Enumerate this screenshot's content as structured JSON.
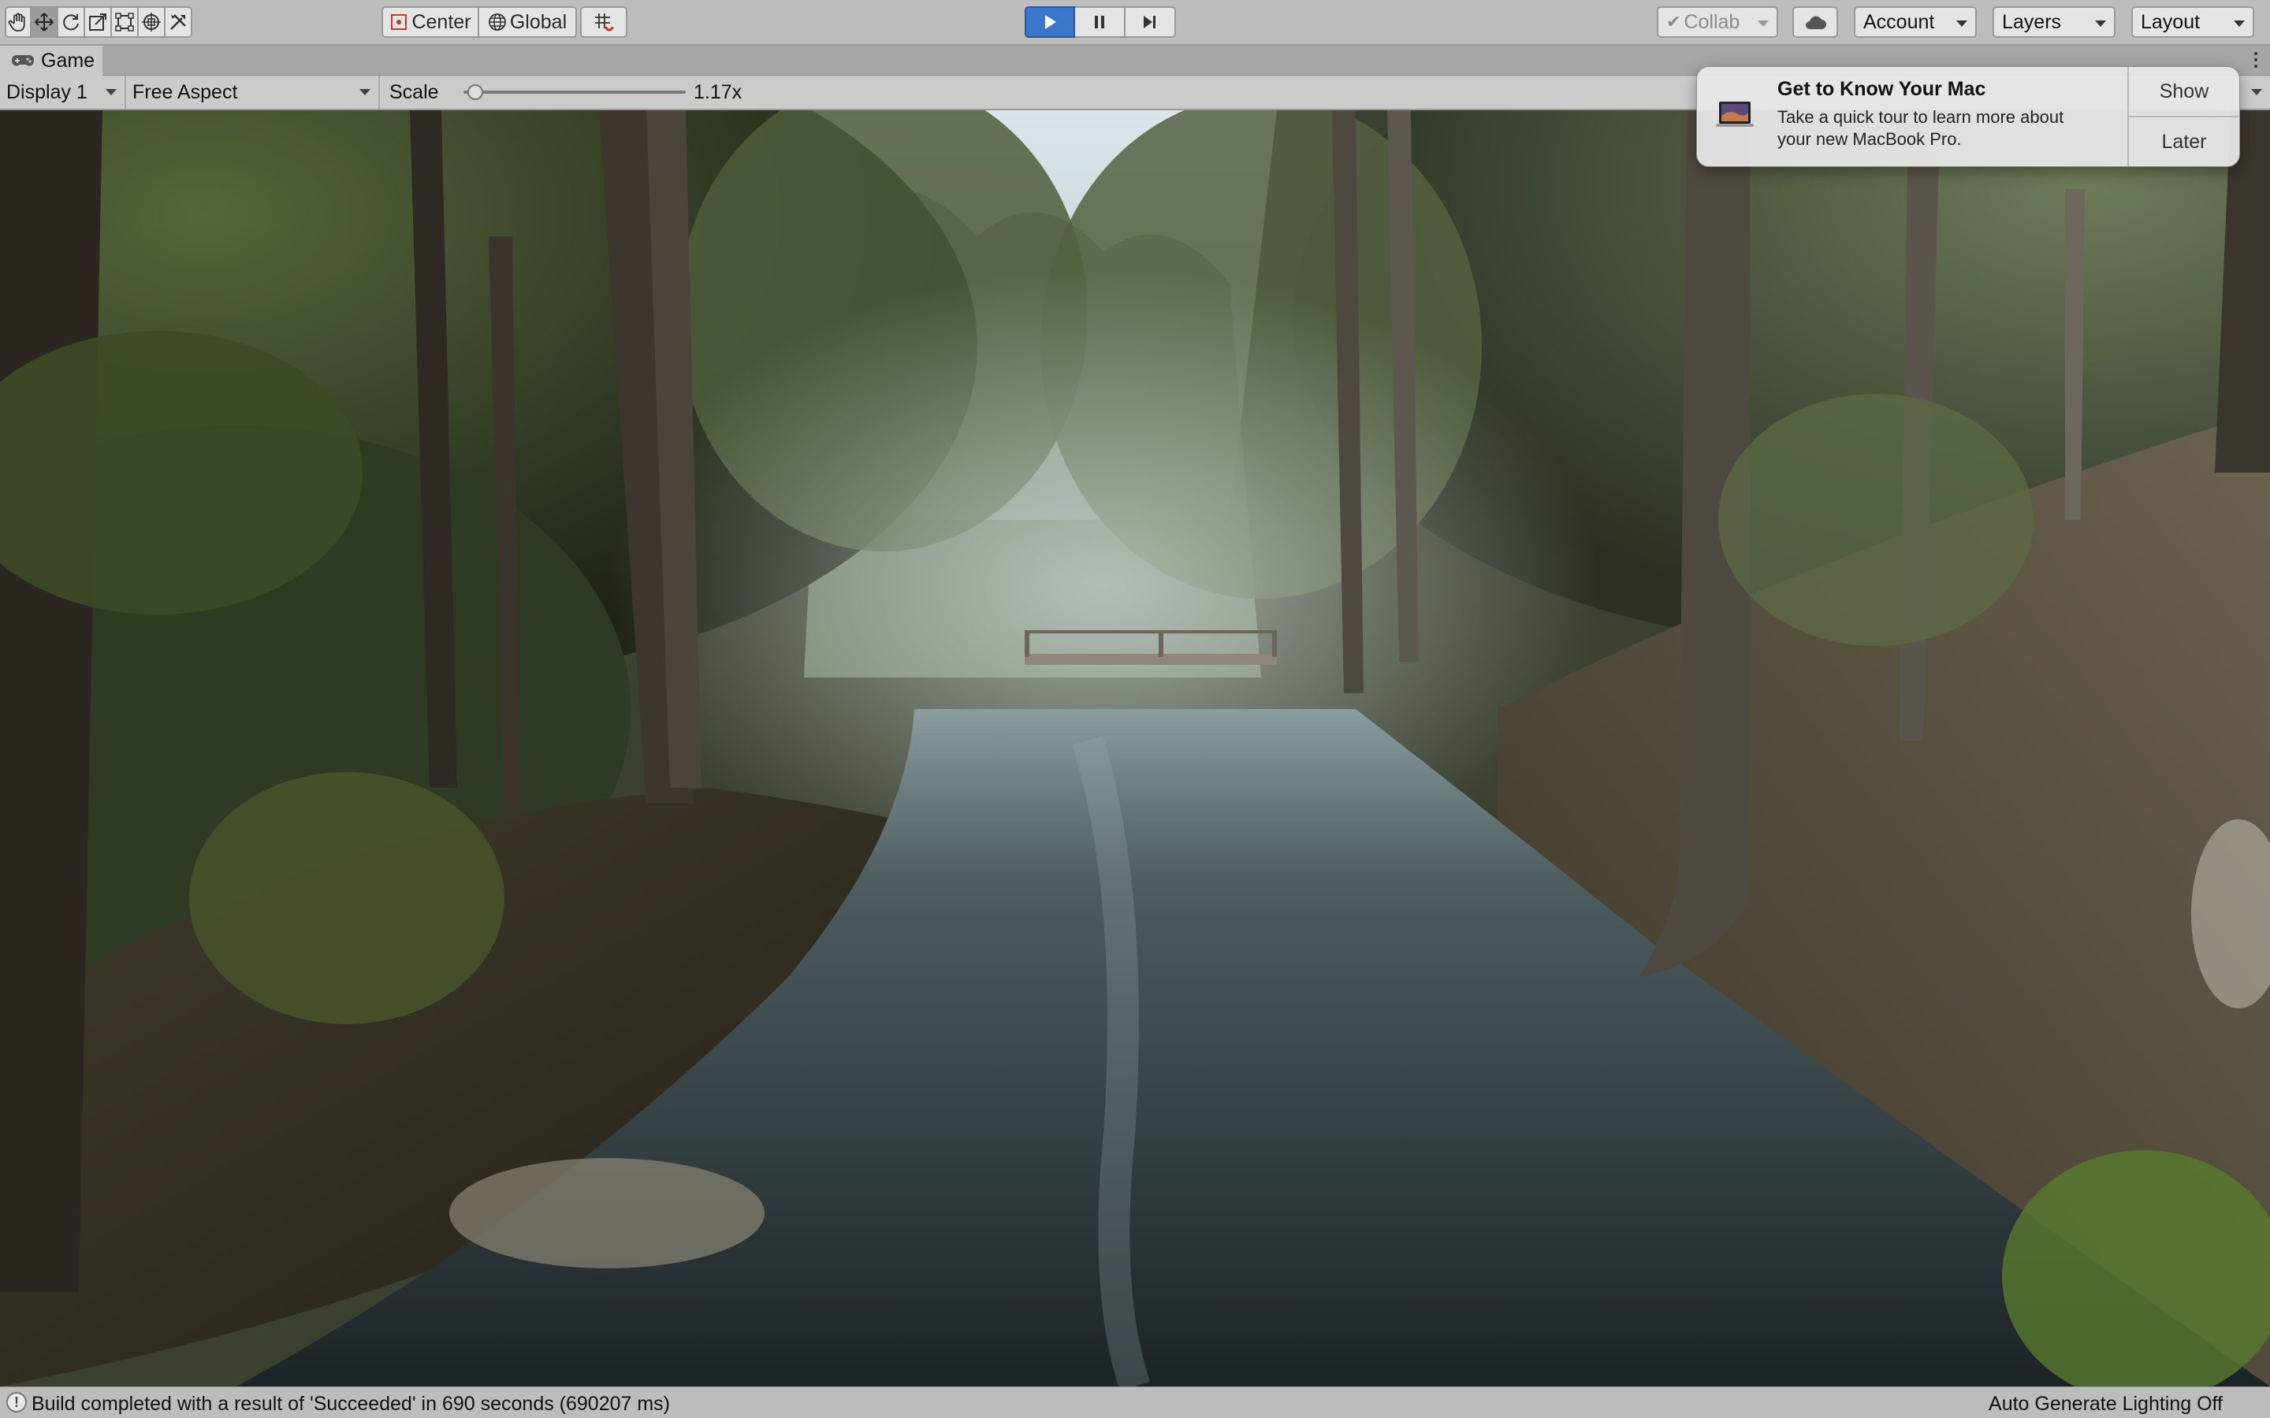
{
  "toolbar": {
    "tools": [
      {
        "name": "hand-tool",
        "icon": "hand-icon"
      },
      {
        "name": "move-tool",
        "icon": "move-icon",
        "active": true
      },
      {
        "name": "rotate-tool",
        "icon": "rotate-icon"
      },
      {
        "name": "scale-tool",
        "icon": "scale-icon"
      },
      {
        "name": "rect-tool",
        "icon": "rect-icon"
      },
      {
        "name": "transform-tool",
        "icon": "transform-icon"
      },
      {
        "name": "custom-tool",
        "icon": "tools-icon"
      }
    ],
    "pivot_label": "Center",
    "space_label": "Global",
    "snap_icon": "grid-snap-icon",
    "play_state": "playing",
    "collab_label": "Collab",
    "cloud_icon": "cloud-icon",
    "account_label": "Account",
    "layers_label": "Layers",
    "layout_label": "Layout"
  },
  "tab": {
    "icon": "gamepad-icon",
    "label": "Game"
  },
  "game_controls": {
    "display": "Display 1",
    "aspect": "Free Aspect",
    "scale_label": "Scale",
    "scale_value": "1.17x",
    "scale_position": 0.02
  },
  "notification": {
    "title": "Get to Know Your Mac",
    "body": "Take a quick tour to learn more about your new MacBook Pro.",
    "show_label": "Show",
    "later_label": "Later"
  },
  "status": {
    "icon": "info-icon",
    "message": "Build completed with a result of 'Succeeded' in 690 seconds (690207 ms)",
    "right_text": "Auto Generate Lighting Off"
  },
  "colors": {
    "toolbar_bg": "#bdbdbd",
    "play_active": "#3a76c9",
    "forest_dark": "#1e2418",
    "water": "#2e3a40",
    "sky": "#c9d6dc"
  }
}
